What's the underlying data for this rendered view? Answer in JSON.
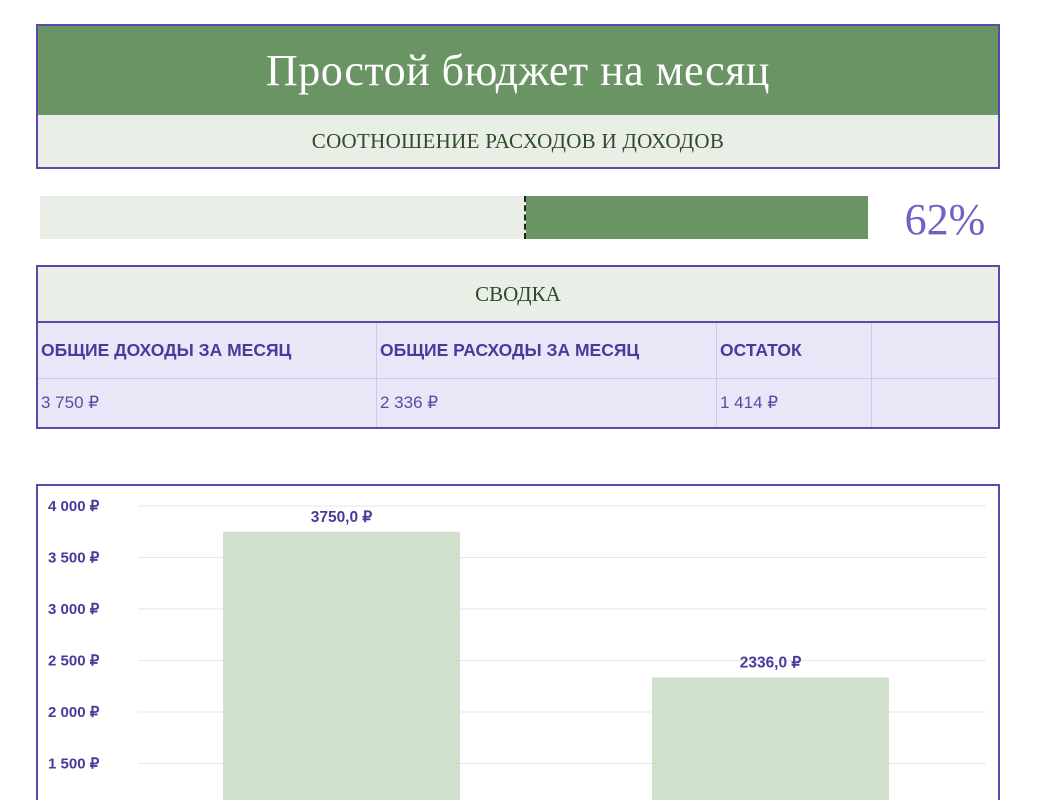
{
  "header": {
    "title": "Простой бюджет на месяц",
    "subtitle": "СООТНОШЕНИЕ РАСХОДОВ И ДОХОДОВ"
  },
  "ratio": {
    "percent_label": "62%",
    "value": 0.62
  },
  "summary": {
    "title": "СВОДКА",
    "headers": [
      "ОБЩИЕ ДОХОДЫ ЗА МЕСЯЦ",
      "ОБЩИЕ РАСХОДЫ ЗА МЕСЯЦ",
      "ОСТАТОК",
      ""
    ],
    "values": [
      "3 750 ₽",
      "2 336 ₽",
      "1 414 ₽",
      ""
    ]
  },
  "colors": {
    "accent_green": "#6a9463",
    "light_green": "#e9efe6",
    "bar_green": "#d0e0cc",
    "purple": "#5b4aa6"
  },
  "chart_data": {
    "type": "bar",
    "categories": [
      "",
      ""
    ],
    "values": [
      3750,
      2336
    ],
    "data_labels": [
      "3750,0 ₽",
      "2336,0 ₽"
    ],
    "ylim": [
      0,
      4000
    ],
    "yticks": [
      4000,
      3500,
      3000,
      2500,
      2000,
      1500
    ],
    "ytick_labels": [
      "4 000 ₽",
      "3 500 ₽",
      "3 000 ₽",
      "2 500 ₽",
      "2 000 ₽",
      "1 500 ₽"
    ],
    "grid": true
  }
}
